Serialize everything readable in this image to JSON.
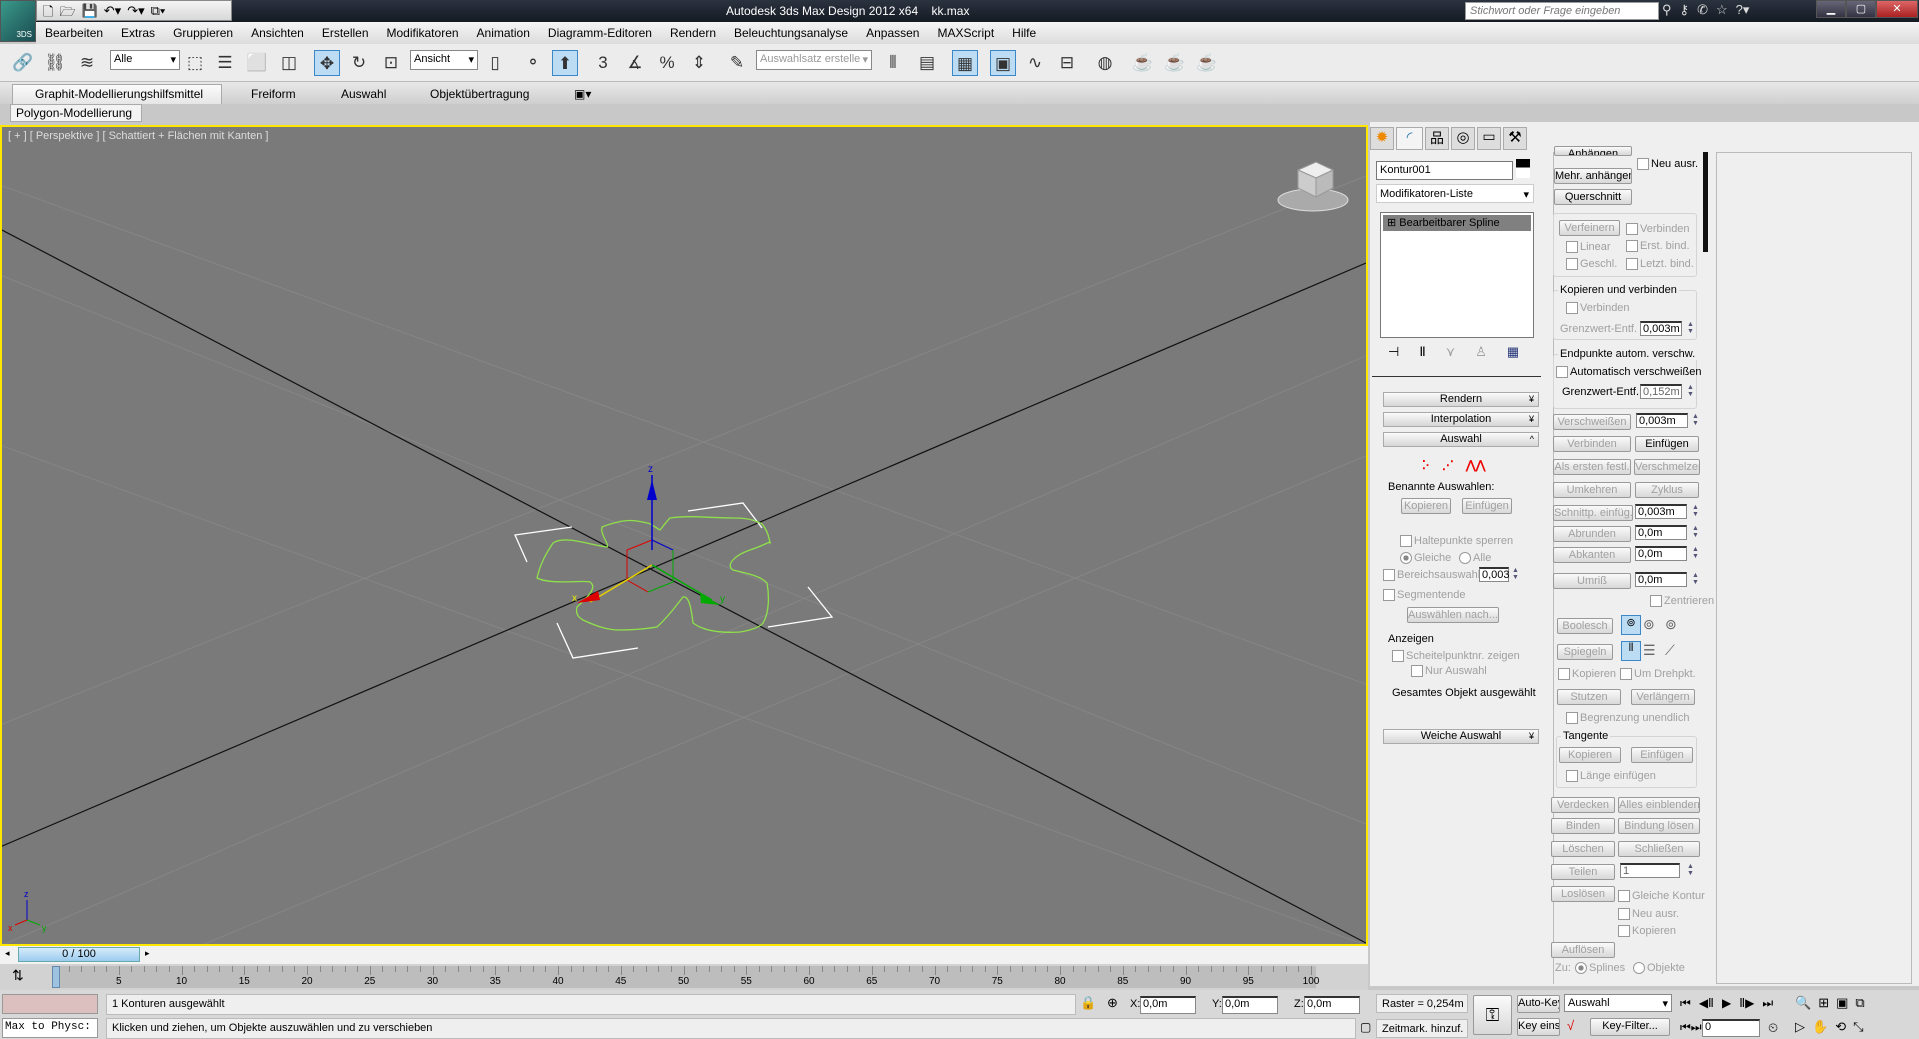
{
  "app": {
    "title": "Autodesk 3ds Max Design 2012 x64",
    "file": "kk.max",
    "logo": "3DS",
    "search_placeholder": "Stichwort oder Frage eingeben"
  },
  "menu": [
    "Bearbeiten",
    "Extras",
    "Gruppieren",
    "Ansichten",
    "Erstellen",
    "Modifikatoren",
    "Animation",
    "Diagramm-Editoren",
    "Rendern",
    "Beleuchtungsanalyse",
    "Anpassen",
    "MAXScript",
    "Hilfe"
  ],
  "toolbar": {
    "selection_filter": "Alle",
    "ref_coord": "Ansicht",
    "named_selection_placeholder": "Auswahlsatz erstelle",
    "snap_value": "3"
  },
  "ribbon": {
    "tabs": [
      "Graphit-Modellierungshilfsmittel",
      "Freiform",
      "Auswahl",
      "Objektübertragung"
    ],
    "panel": "Polygon-Modellierung"
  },
  "viewport": {
    "label": "[ + ] [ Perspektive ] [ Schattiert + Flächen mit Kanten ]",
    "axis_x": "x",
    "axis_y": "y",
    "axis_z": "z",
    "active_border": "#ffe600",
    "spline_color": "#8fe04a"
  },
  "command_panel": {
    "object_name": "Kontur001",
    "modifier_list": "Modifikatoren-Liste",
    "stack_item": "Bearbeitbarer Spline",
    "rollouts": {
      "rendern": "Rendern",
      "interpolation": "Interpolation",
      "auswahl": "Auswahl",
      "weiche": "Weiche Auswahl"
    },
    "selection": {
      "named": "Benannte Auswahlen:",
      "kopieren": "Kopieren",
      "einfuegen": "Einfügen",
      "halte": "Haltepunkte sperren",
      "gleiche": "Gleiche",
      "alle": "Alle",
      "bereich": "Bereichsauswahl:",
      "bereich_val": "0,003",
      "segmentende": "Segmentende",
      "auswaehlen_nach": "Auswählen nach...",
      "anzeigen": "Anzeigen",
      "scheitel": "Scheitelpunktnr. zeigen",
      "nur": "Nur Auswahl",
      "status": "Gesamtes Objekt ausgewählt"
    },
    "geometry": {
      "anhaengen": "Anhängen",
      "neu_ausr": "Neu ausr.",
      "mehr": "Mehr. anhängen",
      "querschnitt": "Querschnitt",
      "verfeinern": "Verfeinern",
      "verbinden": "Verbinden",
      "linear": "Linear",
      "erst": "Erst. bind.",
      "geschl": "Geschl.",
      "letzt": "Letzt. bind.",
      "kop_verb": "Kopieren und verbinden",
      "grenz": "Grenzwert-Entf.",
      "grenz1": "0,003m",
      "endpunkte": "Endpunkte autom. verschw.",
      "auto": "Automatisch verschweißen",
      "grenz2": "0,152m",
      "verschweissen": "Verschweißen",
      "versch_val": "0,003m",
      "einfuegen": "Einfügen",
      "als_ersten": "Als ersten festl.",
      "verschmelzen": "Verschmelzen",
      "umkehren": "Umkehren",
      "zyklus": "Zyklus",
      "schnittp": "Schnittp. einfüg.",
      "schnitt_val": "0,003m",
      "abrunden": "Abrunden",
      "abrunden_val": "0,0m",
      "abkanten": "Abkanten",
      "abkanten_val": "0,0m",
      "umriss": "Umriß",
      "umriss_val": "0,0m",
      "zentrieren": "Zentrieren",
      "boolesch": "Boolesch",
      "spiegeln": "Spiegeln",
      "kopieren": "Kopieren",
      "um_drehpkt": "Um Drehpkt.",
      "stutzen": "Stutzen",
      "verlaengern": "Verlängern",
      "begrenzung": "Begrenzung unendlich",
      "tangente": "Tangente",
      "t_kopieren": "Kopieren",
      "t_einfuegen": "Einfügen",
      "laenge": "Länge einfügen",
      "verdecken": "Verdecken",
      "alles": "Alles einblenden",
      "binden": "Binden",
      "bindung": "Bindung lösen",
      "loeschen": "Löschen",
      "schliessen": "Schließen",
      "teilen": "Teilen",
      "teilen_val": "1",
      "losloesen": "Loslösen",
      "gleiche_kontur": "Gleiche Kontur",
      "neu_ausr2": "Neu ausr.",
      "kopieren2": "Kopieren",
      "aufloesen": "Auflösen",
      "zu": "Zu:",
      "splines": "Splines",
      "objekte": "Objekte"
    }
  },
  "timeline": {
    "slider": "0 / 100",
    "ticks": [
      "0",
      "5",
      "10",
      "15",
      "20",
      "25",
      "30",
      "35",
      "40",
      "45",
      "50",
      "55",
      "60",
      "65",
      "70",
      "75",
      "80",
      "85",
      "90",
      "95",
      "100"
    ]
  },
  "status": {
    "script_listener": "Max to Physc:",
    "message1": "1 Konturen ausgewählt",
    "message2": "Klicken und ziehen, um Objekte auszuwählen und zu verschieben",
    "x_label": "X:",
    "x": "0,0m",
    "y_label": "Y:",
    "y": "0,0m",
    "z_label": "Z:",
    "z": "0,0m",
    "raster": "Raster = 0,254m",
    "zeitmark": "Zeitmark. hinzuf.",
    "auto_key": "Auto-Key",
    "key_mode": "Auswahl",
    "key_eins": "Key eins.",
    "key_filter": "Key-Filter...",
    "frame": "0"
  }
}
